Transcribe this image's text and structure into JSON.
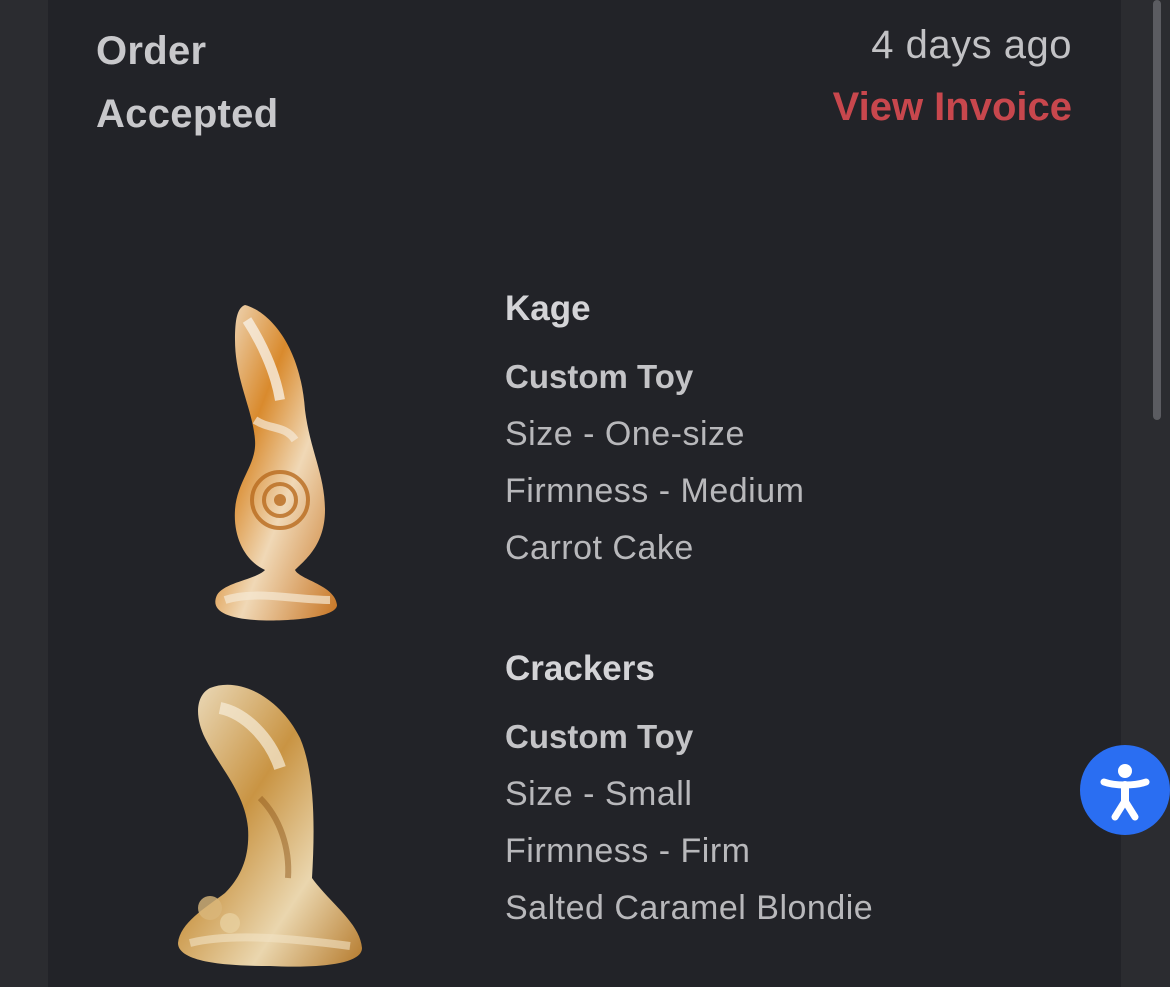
{
  "order": {
    "status": "Order Accepted",
    "time_ago": "4 days ago",
    "invoice_link": "View Invoice"
  },
  "items": [
    {
      "name": "Kage",
      "type": "Custom Toy",
      "size": "Size - One-size",
      "firmness": "Firmness - Medium",
      "color": "Carrot Cake"
    },
    {
      "name": "Crackers",
      "type": "Custom Toy",
      "size": "Size - Small",
      "firmness": "Firmness - Firm",
      "color": "Salted Caramel Blondie"
    }
  ],
  "accessibility_button": {
    "icon": "accessibility-person-icon"
  },
  "colors": {
    "card_background": "#222328",
    "page_background": "#2b2c30",
    "invoice_link": "#c8474d",
    "accessibility_button": "#2a6ef2"
  }
}
